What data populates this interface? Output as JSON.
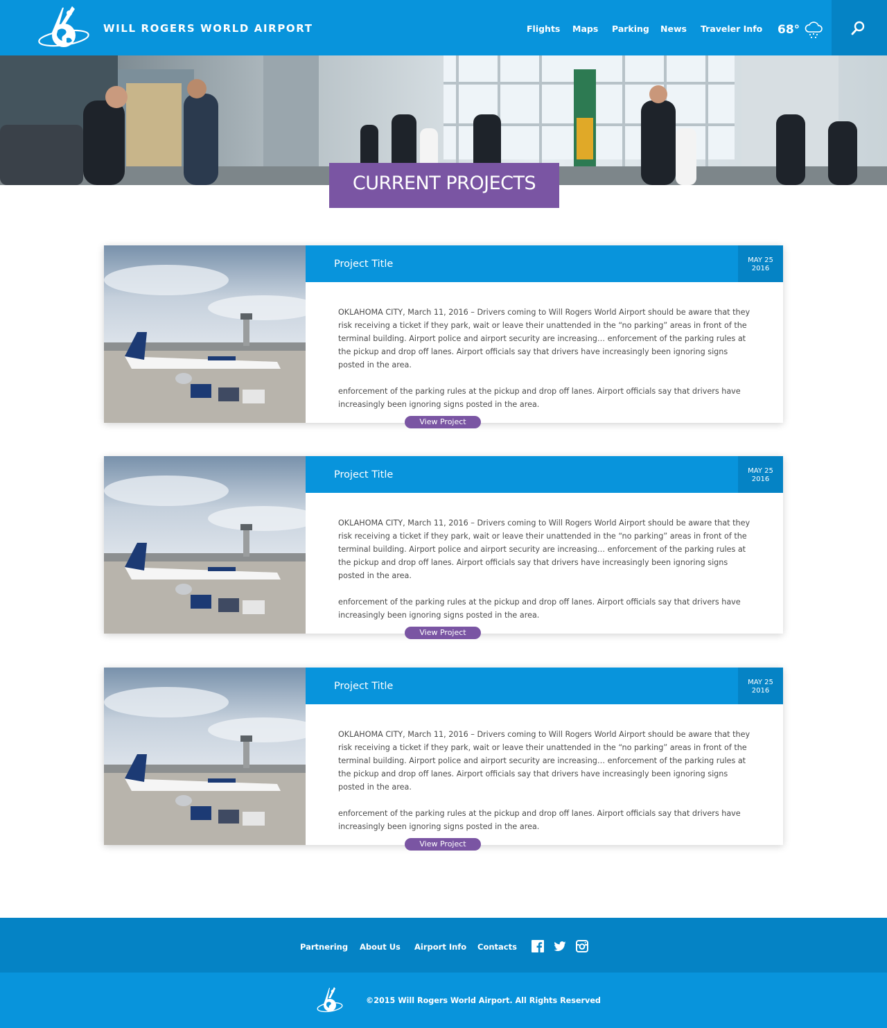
{
  "header": {
    "site_name": "WILL ROGERS WORLD AIRPORT",
    "nav": [
      "Flights",
      "Maps",
      "Parking",
      "News",
      "Traveler Info"
    ],
    "weather": {
      "temperature": "68°",
      "icon": "snow-cloud-icon"
    },
    "search_icon": "search-icon"
  },
  "hero": {
    "title": "CURRENT PROJECTS"
  },
  "projects": [
    {
      "title": "Project Title",
      "date_month_day": "MAY 25",
      "date_year": "2016",
      "paragraph_1": "OKLAHOMA CITY, March 11, 2016 – Drivers coming to Will Rogers World Airport should be aware that they risk receiving a ticket if they park, wait or leave their unattended in the “no parking” areas in front of the terminal building. Airport police and airport security are increasing… enforcement of the parking rules at the pickup and drop off lanes. Airport officials say that drivers have increasingly been ignoring signs posted in the area.",
      "paragraph_2": "enforcement of the parking rules at the pickup and drop off lanes. Airport officials say that drivers have increasingly been ignoring signs posted in the area.",
      "button": "View Project"
    },
    {
      "title": "Project Title",
      "date_month_day": "MAY 25",
      "date_year": "2016",
      "paragraph_1": "OKLAHOMA CITY, March 11, 2016 – Drivers coming to Will Rogers World Airport should be aware that they risk receiving a ticket if they park, wait or leave their unattended in the “no parking” areas in front of the terminal building. Airport police and airport security are increasing… enforcement of the parking rules at the pickup and drop off lanes. Airport officials say that drivers have increasingly been ignoring signs posted in the area.",
      "paragraph_2": "enforcement of the parking rules at the pickup and drop off lanes. Airport officials say that drivers have increasingly been ignoring signs posted in the area.",
      "button": "View Project"
    },
    {
      "title": "Project Title",
      "date_month_day": "MAY 25",
      "date_year": "2016",
      "paragraph_1": "OKLAHOMA CITY, March 11, 2016 – Drivers coming to Will Rogers World Airport should be aware that they risk receiving a ticket if they park, wait or leave their unattended in the “no parking” areas in front of the terminal building. Airport police and airport security are increasing… enforcement of the parking rules at the pickup and drop off lanes. Airport officials say that drivers have increasingly been ignoring signs posted in the area.",
      "paragraph_2": "enforcement of the parking rules at the pickup and drop off lanes. Airport officials say that drivers have increasingly been ignoring signs posted in the area.",
      "button": "View Project"
    }
  ],
  "footer": {
    "links": [
      "Partnering",
      "About Us",
      "Airport Info",
      "Contacts"
    ],
    "social_icons": [
      "facebook-icon",
      "twitter-icon",
      "instagram-icon"
    ],
    "copyright": "©2015 Will Rogers World Airport. All Rights Reserved"
  },
  "colors": {
    "primary_blue": "#0894dc",
    "dark_blue": "#0583c5",
    "accent_purple": "#7a55a3"
  }
}
